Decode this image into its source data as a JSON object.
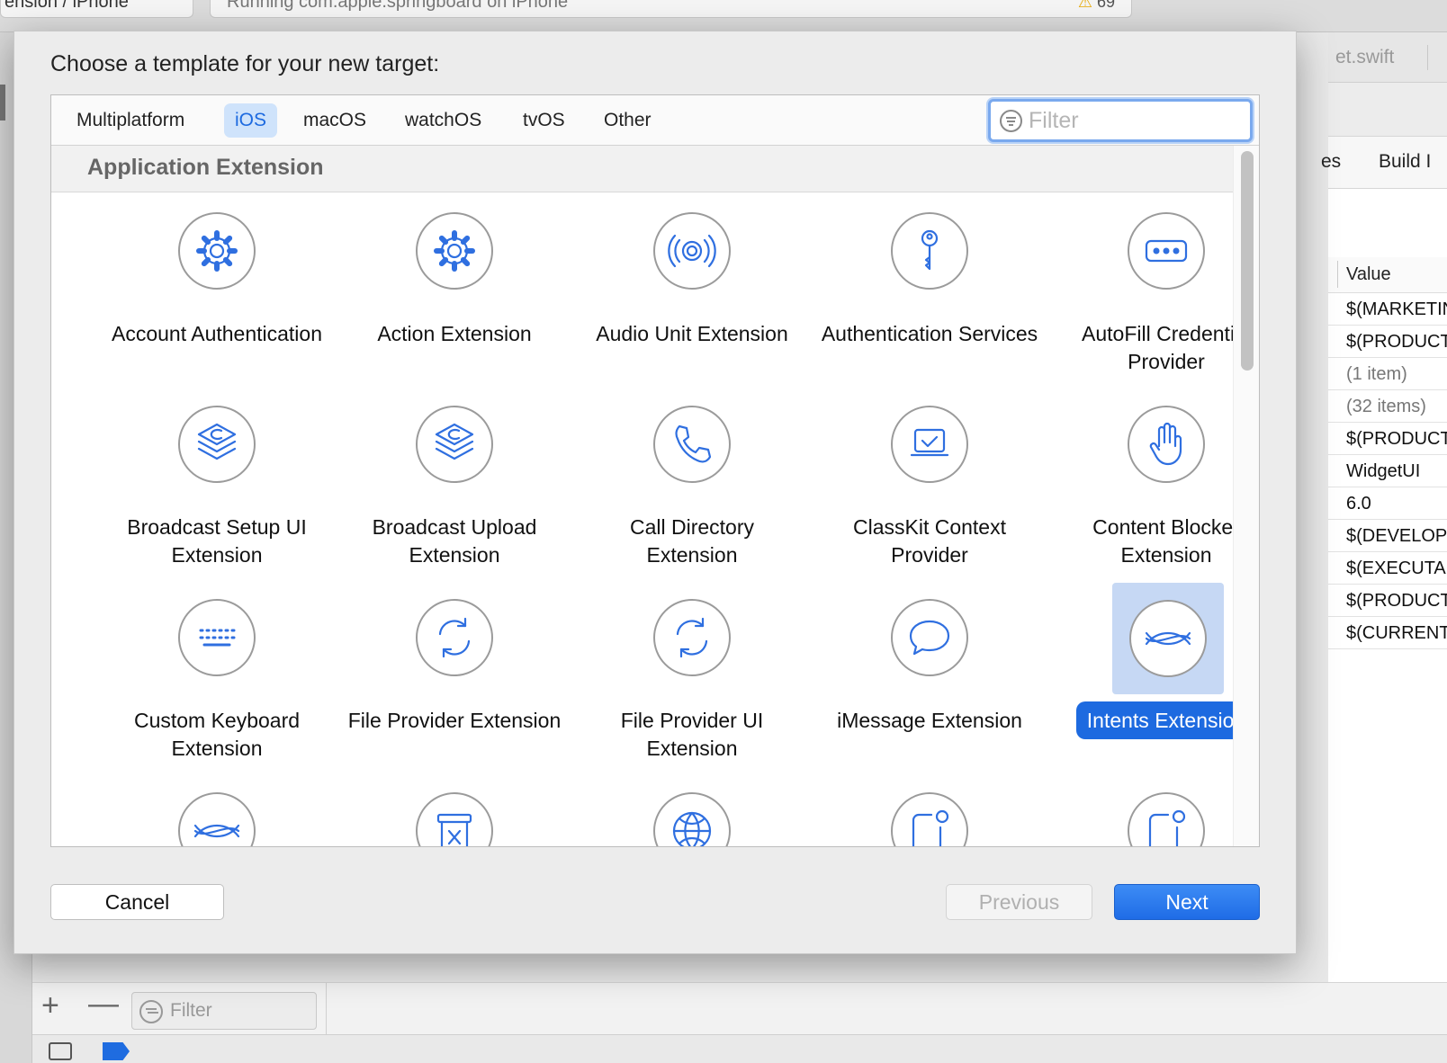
{
  "background": {
    "scheme_text": "ension  /  iPhone",
    "activity_text": "Running com.apple.springboard on iPhone",
    "warning_count": "69",
    "file_tab": "et.swift",
    "tabs": [
      "es",
      "Build I"
    ],
    "column_header": "Value",
    "values": [
      "$(MARKETING_VERSION)",
      "$(PRODUCT_MODULE_NAME)",
      "(1 item)",
      "(32 items)",
      "$(PRODUCT_BUNDLE_IDENTIFIER)",
      "WidgetUI",
      "6.0",
      "$(DEVELOPMENT_LANGUAGE)",
      "$(EXECUTABLE_NAME)",
      "$(PRODUCT_NAME)",
      "$(CURRENT_PROJECT_VERSION)"
    ],
    "filter_placeholder": "Filter"
  },
  "sheet": {
    "title": "Choose a template for your new target:",
    "platform_tabs": [
      "Multiplatform",
      "iOS",
      "macOS",
      "watchOS",
      "tvOS",
      "Other"
    ],
    "selected_tab": "iOS",
    "filter_placeholder": "Filter",
    "section_title": "Application Extension",
    "templates": [
      {
        "name": "Account Authentication",
        "icon": "gear-icon"
      },
      {
        "name": "Action Extension",
        "icon": "gear-icon"
      },
      {
        "name": "Audio Unit Extension",
        "icon": "audio-waves-icon"
      },
      {
        "name": "Authentication Services",
        "icon": "key-icon"
      },
      {
        "name": "AutoFill Credential Provider",
        "icon": "password-dots-icon"
      },
      {
        "name": "Broadcast Setup UI Extension",
        "icon": "broadcast-stack-icon"
      },
      {
        "name": "Broadcast Upload Extension",
        "icon": "broadcast-stack-icon"
      },
      {
        "name": "Call Directory Extension",
        "icon": "phone-icon"
      },
      {
        "name": "ClassKit Context Provider",
        "icon": "classkit-icon"
      },
      {
        "name": "Content Blocker Extension",
        "icon": "hand-icon"
      },
      {
        "name": "Custom Keyboard Extension",
        "icon": "keyboard-icon"
      },
      {
        "name": "File Provider Extension",
        "icon": "sync-arrows-icon"
      },
      {
        "name": "File Provider UI Extension",
        "icon": "sync-arrows-icon"
      },
      {
        "name": "iMessage Extension",
        "icon": "speech-bubble-icon"
      },
      {
        "name": "Intents Extension",
        "icon": "intents-waves-icon",
        "selected": true
      },
      {
        "name": "",
        "icon": "intents-waves-icon"
      },
      {
        "name": "",
        "icon": "trash-can-icon"
      },
      {
        "name": "",
        "icon": "globe-icon"
      },
      {
        "name": "",
        "icon": "notification-icon"
      },
      {
        "name": "",
        "icon": "notification-icon"
      }
    ],
    "buttons": {
      "cancel": "Cancel",
      "previous": "Previous",
      "next": "Next"
    }
  },
  "colors": {
    "accent": "#1d6ae0",
    "icon_stroke": "#2f6fe0",
    "selection_bg": "#c6d8f4"
  }
}
